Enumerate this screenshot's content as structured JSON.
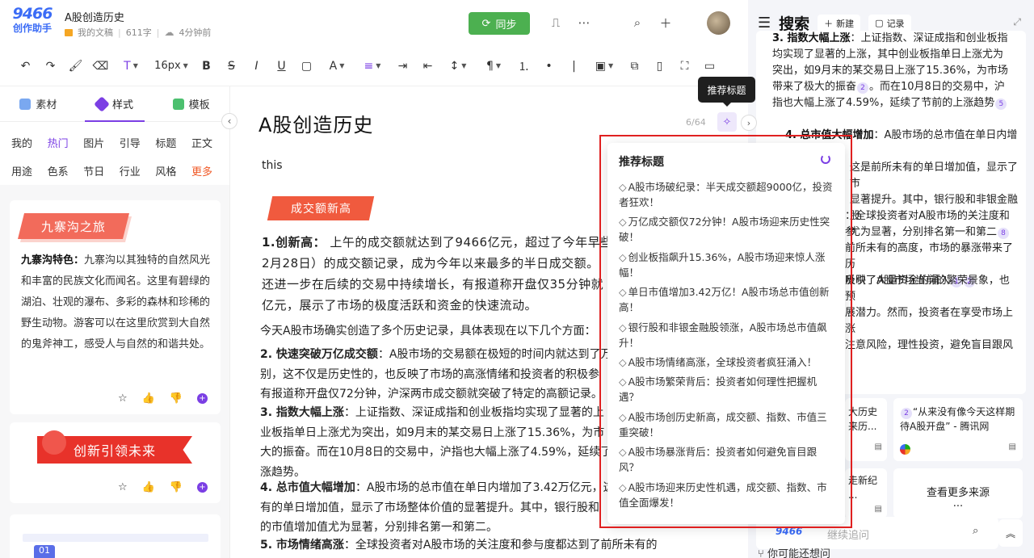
{
  "app": {
    "logo_num": "9466",
    "logo_sub": "创作助手",
    "doc_title": "A股创造历史",
    "folder": "我的文稿",
    "word_count": "611字",
    "saved_time": "4分钟前",
    "sync_label": "同步"
  },
  "toolbar": {
    "font_size": "16px"
  },
  "left": {
    "tabs": [
      "素材",
      "样式",
      "模板"
    ],
    "cats_row1": [
      "我的",
      "热门",
      "图片",
      "引导",
      "标题",
      "正文"
    ],
    "cats_row2": [
      "用途",
      "色系",
      "节日",
      "行业",
      "风格",
      "更多"
    ],
    "card1": {
      "ribbon": "九寨沟之旅",
      "bold": "九寨沟特色：",
      "text": "九寨沟以其独特的自然风光和丰富的民族文化而闻名。这里有碧绿的湖泊、壮观的瀑布、多彩的森林和珍稀的野生动物。游客可以在这里欣赏到大自然的鬼斧神工，感受人与自然的和谐共处。"
    },
    "card2": {
      "banner": "创新引领未来"
    },
    "card3": {
      "num": "01"
    }
  },
  "editor": {
    "title": "A股创造历史",
    "title_count": "6/64",
    "p_this": "this",
    "tag": "成交额新高",
    "p1_bold": "1.创新高：",
    "p1_text": "上午的成交额就达到了9466亿元，超过了今年早些",
    "p1_l2": "2月28日）的成交额记录，成为今年以来最多的半日成交额。",
    "p1_l3": "还进一步在后续的交易中持续增长，有报道称开盘仅35分钟就",
    "p1_l4": "亿元，展示了市场的极度活跃和资金的快速流动。",
    "p2": "今天A股市场确实创造了多个历史记录，具体表现在以下几个方面：",
    "p3_bold": "2. 快速突破万亿成交额",
    "p3_l1": "：A股市场的交易额在极短的时间内就达到了万",
    "p3_l2": "别，这不仅是历史性的，也反映了市场的高涨情绪和投资者的积极参",
    "p3_l3": "有报道称开盘仅72分钟，沪深两市成交额就突破了特定的高额记录。",
    "p4_bold": "3. 指数大幅上涨",
    "p4_l1": "：上证指数、深证成指和创业板指均实现了显著的上",
    "p4_l2": "业板指单日上涨尤为突出，如9月末的某交易日上涨了15.36%，为市",
    "p4_l3": "大的振奋。而在10月8日的交易中，沪指也大幅上涨了4.59%，延续了",
    "p4_l4": "涨趋势。",
    "p5_bold": "4. 总市值大幅增加",
    "p5_l1": "：A股市场的总市值在单日内增加了3.42万亿元，这",
    "p5_l2": "有的单日增加值，显示了市场整体价值的显著提升。其中，银行股和",
    "p5_l3": "的市值增加值尤为显著，分别排名第一和第二。",
    "p6_bold": "5. 市场情绪高涨",
    "p6_l1": "：全球投资者对A股市场的关注度和参与度都达到了前所未有的"
  },
  "popover": {
    "tooltip": "推荐标题",
    "title": "推荐标题",
    "items": [
      "A股市场破纪录：半天成交额超9000亿，投资者狂欢！",
      "万亿成交额仅72分钟！A股市场迎来历史性突破！",
      "创业板指飙升15.36%，A股市场迎来惊人涨幅！",
      "单日市值增加3.42万亿！A股市场总市值创新高！",
      "银行股和非银金融股领涨，A股市场总市值飙升！",
      "A股市场情绪高涨，全球投资者疯狂涌入！",
      "A股市场繁荣背后：投资者如何理性把握机遇？",
      "A股市场创历史新高，成交额、指数、市值三重突破！",
      "A股市场暴涨背后：投资者如何避免盲目跟风？",
      "A股市场迎来历史性机遇，成交额、指数、市值全面爆发！"
    ]
  },
  "right": {
    "title": "搜索",
    "new_label": "新建",
    "record_label": "记录",
    "a1_bold": "3. 指数大幅上涨",
    "a1": "：上证指数、深证成指和创业板指均实现了显著的上涨，其中创业板指单日上涨尤为突出，如9月末的某交易日上涨了15.36%，为市场带来了极大的振奋",
    "a1b": "。而在10月8日的交易中，沪指也大幅上涨了4.59%，延续了节前的上涨趋势",
    "cite2": "2",
    "cite5": "5",
    "a2_bold": "4. 总市值大幅增加",
    "a2_l1": "：A股市场的总市值在单日内增加了",
    "a2_l2": "这是前所未有的单日增加值，显示了市",
    "a2_l3": "显著提升。其中，银行股和非银金融股",
    "a2_l4": "尤为显著，分别排名第一和第二",
    "cite8": "8",
    "a3_l1": "：全球投资者对A股市场的关注度和参",
    "a3_l2": "前所未有的高度，市场的暴涨带来了历",
    "a3_l3": "吸引了大量资金的涌入",
    "cite1": "1",
    "a4_l1": "反映了A股市场当前的繁荣景象，也预",
    "a4_l2": "展潜力。然而，投资者在享受市场上涨",
    "a4_l3": "注意风险，理性投资，避免盲目跟风",
    "src1_text": "大历史",
    "src1_text2": "来历...",
    "src2_title": "“从来没有像今天这样期待A股开盘” - 腾讯网",
    "src3_text": "走新纪",
    "src3_text2": "...",
    "src4": "查看更多来源",
    "src4_dots": "...",
    "chat_logo": "9466",
    "chat_placeholder": "继续追问",
    "maybe": "你可能还想问"
  }
}
